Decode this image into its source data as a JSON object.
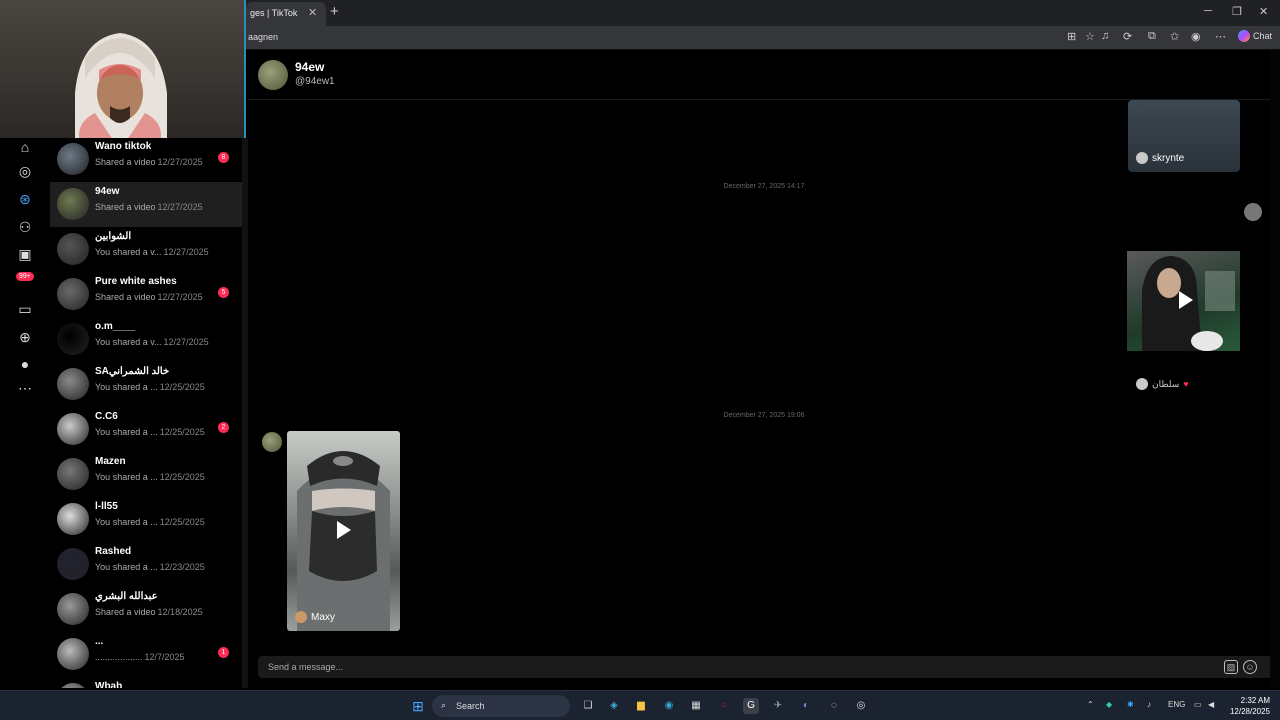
{
  "browser": {
    "tab_title": "ges | TikTok",
    "tab_close": "✕",
    "new_tab": "+",
    "url": "aagnen",
    "chat_label": "Chat"
  },
  "conversations": [
    {
      "name": "Wano tiktok",
      "line": "Shared a video",
      "date": "12/27/2025",
      "unread": "8",
      "avatar_color": "#6c7a8a"
    },
    {
      "name": "94ew",
      "line": "Shared a video",
      "date": "12/27/2025",
      "unread": "",
      "avatar_color": "#6f7a50",
      "active": true
    },
    {
      "name": "الشوابين",
      "line": "You shared a v...",
      "date": "12/27/2025",
      "unread": "",
      "avatar_color": "#555"
    },
    {
      "name": "Pure white ashes",
      "line": "Shared a video",
      "date": "12/27/2025",
      "unread": "5",
      "avatar_color": "#6a6a6a"
    },
    {
      "name": "o.m____",
      "line": "You shared a v...",
      "date": "12/27/2025",
      "unread": "",
      "avatar_color": "#000"
    },
    {
      "name": "SAخالد الشمراني",
      "line": "You shared a ...",
      "date": "12/25/2025",
      "unread": "",
      "avatar_color": "#8a8a8a"
    },
    {
      "name": "C.C6",
      "line": "You shared a ...",
      "date": "12/25/2025",
      "unread": "2",
      "avatar_color": "#ccc"
    },
    {
      "name": "Mazen",
      "line": "You shared a ...",
      "date": "12/25/2025",
      "unread": "",
      "avatar_color": "#777"
    },
    {
      "name": "l-ll55",
      "line": "You shared a ...",
      "date": "12/25/2025",
      "unread": "",
      "avatar_color": "#ddd"
    },
    {
      "name": "Rashed",
      "line": "You shared a ...",
      "date": "12/23/2025",
      "unread": "",
      "avatar_color": "#223"
    },
    {
      "name": "عبدالله البشري",
      "line": "Shared a video",
      "date": "12/18/2025",
      "unread": "",
      "avatar_color": "#999"
    },
    {
      "name": "...",
      "line": "...................",
      "date": "12/7/2025",
      "unread": "1",
      "avatar_color": "#bbb"
    },
    {
      "name": "Wbab",
      "line": "",
      "date": "",
      "unread": "",
      "avatar_color": "#aaa"
    }
  ],
  "rail": {
    "badge": "99+"
  },
  "chat": {
    "name": "94ew",
    "handle": "@94ew1",
    "timestamp1": "December 27, 2025 14:17",
    "timestamp2": "December 27, 2025 19:06",
    "card_top_user": "skrynte",
    "card_mid_user": "سلطان",
    "card_left_user": "Maxy",
    "message_placeholder": "Send a message..."
  },
  "taskbar": {
    "search": "Search",
    "lang": "ENG",
    "time": "2:32 AM",
    "date": "12/28/2025"
  }
}
